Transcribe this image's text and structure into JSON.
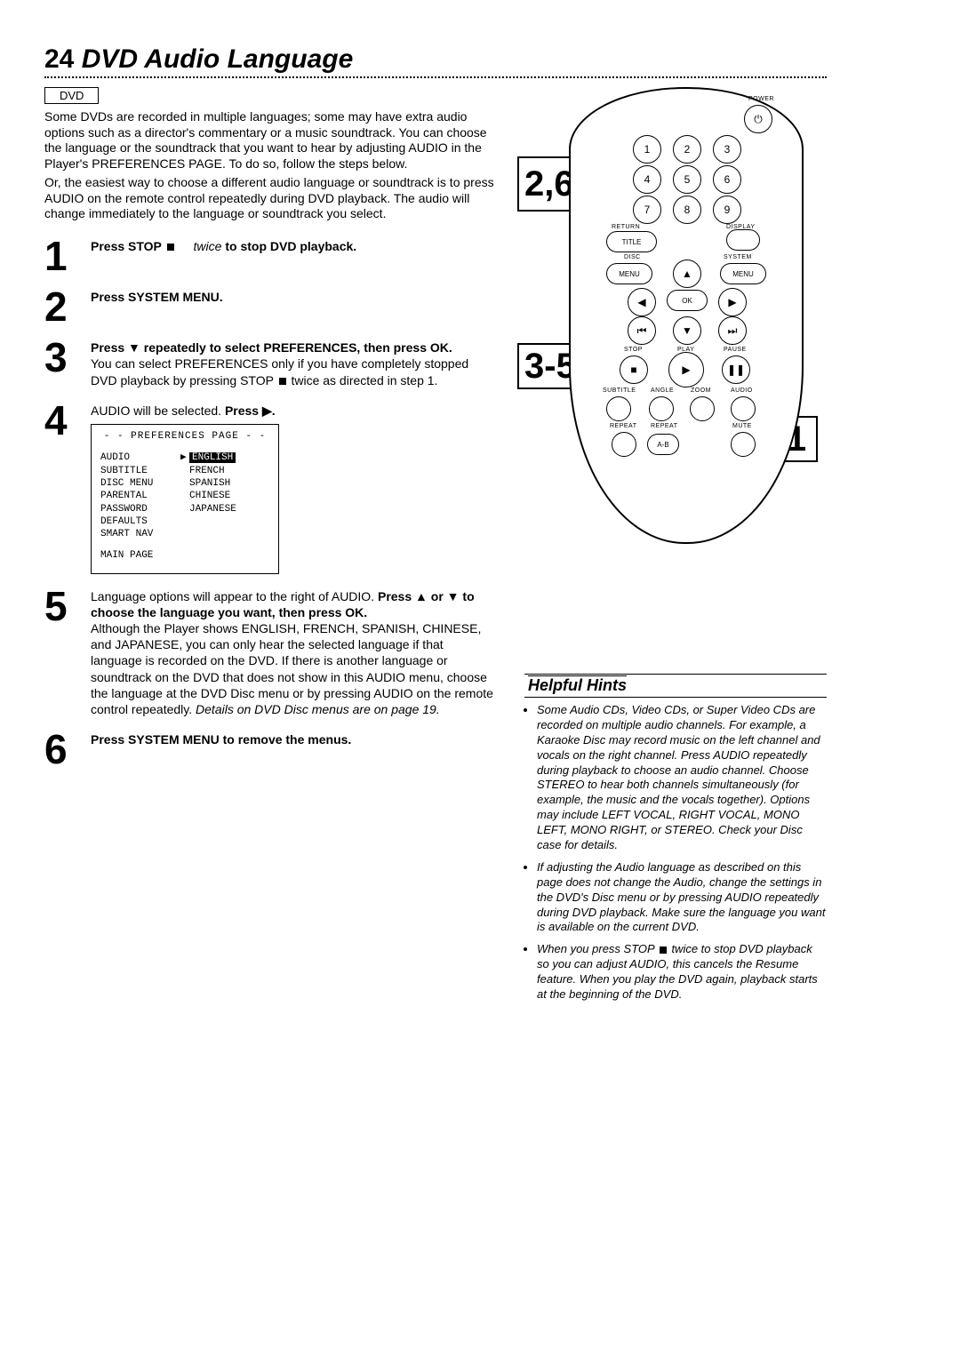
{
  "page": {
    "number": "24",
    "title": "DVD Audio Language"
  },
  "tag": "DVD",
  "intro": {
    "p1": "Some DVDs are recorded in multiple languages; some may have extra audio options such as a director's commentary or a music soundtrack. You can choose the language or the soundtrack that you want to hear by adjusting AUDIO in the Player's PREFERENCES PAGE. To do so, follow the steps below.",
    "p2": "Or, the easiest way to choose a different audio language or soundtrack is to press AUDIO on the remote control repeatedly during DVD playback. The audio will change immediately to the language or soundtrack you select."
  },
  "steps": {
    "s1": {
      "num": "1",
      "bold": "Press STOP ",
      "italic": "twice",
      "rest": " to stop DVD playback."
    },
    "s2": {
      "num": "2",
      "bold": "Press SYSTEM MENU."
    },
    "s3": {
      "num": "3",
      "bold": "Press ▼ repeatedly to select PREFERENCES, then press OK.",
      "rest1": "You can select PREFERENCES only if you have completely stopped DVD playback by pressing STOP ",
      "rest2": " twice as directed in step 1."
    },
    "s4": {
      "num": "4",
      "pre": "AUDIO will be selected. ",
      "bold": "Press ▶."
    },
    "s5": {
      "num": "5",
      "pre": "Language options will appear to the right of AUDIO. ",
      "bold1": "Press ▲ or ▼ to choose the language you want, then press OK.",
      "rest": "Although the Player shows ENGLISH, FRENCH, SPANISH, CHINESE, and JAPANESE, you can only hear the selected language if that language is recorded on the DVD. If there is another language or soundtrack on the DVD that does not show in this AUDIO menu, choose the language at the DVD Disc menu or by pressing AUDIO on the remote control repeatedly. ",
      "italic": "Details on DVD Disc menus are on page 19."
    },
    "s6": {
      "num": "6",
      "bold": "Press SYSTEM MENU to remove the menus."
    }
  },
  "osd": {
    "title": "- -  PREFERENCES PAGE  - -",
    "rows_left": [
      "AUDIO",
      "SUBTITLE",
      "DISC MENU",
      "PARENTAL",
      "PASSWORD",
      "DEFAULTS",
      "SMART NAV"
    ],
    "rows_right": [
      "ENGLISH",
      "FRENCH",
      "SPANISH",
      "CHINESE",
      "JAPANESE"
    ],
    "footer": "MAIN PAGE"
  },
  "remote": {
    "labels": {
      "power": "POWER",
      "return": "RETURN",
      "display": "DISPLAY",
      "title": "TITLE",
      "disc": "DISC",
      "system": "SYSTEM",
      "menu_l": "MENU",
      "menu_r": "MENU",
      "ok": "OK",
      "stop": "STOP",
      "play": "PLAY",
      "pause": "PAUSE",
      "subtitle": "SUBTITLE",
      "angle": "ANGLE",
      "zoom": "ZOOM",
      "audio": "AUDIO",
      "repeat": "REPEAT",
      "repeat2": "REPEAT",
      "mute": "MUTE",
      "ab": "A-B"
    },
    "digits": [
      "1",
      "2",
      "3",
      "4",
      "5",
      "6",
      "7",
      "8",
      "9"
    ]
  },
  "callouts": {
    "c26": "2,6",
    "c35": "3-5",
    "c1": "1"
  },
  "hints": {
    "title": "Helpful Hints",
    "h1": "Some Audio CDs, Video CDs, or Super Video CDs are recorded on multiple audio channels. For example, a Karaoke Disc may record music on the left channel and vocals on the right channel. Press AUDIO repeatedly during playback to choose an audio channel. Choose STEREO to hear both channels simultaneously (for example, the music and the vocals together). Options may include LEFT VOCAL, RIGHT VOCAL, MONO LEFT, MONO RIGHT, or STEREO. Check your Disc case for details.",
    "h2": "If adjusting the Audio language as described on this page does not change the Audio, change the settings in the DVD's Disc menu or by pressing AUDIO repeatedly during DVD playback. Make sure the language you want is available on the current DVD.",
    "h3a": "When you press STOP ",
    "h3b": " twice to stop DVD playback so you can adjust AUDIO, this cancels the Resume feature. When you play the DVD again, playback starts at the beginning of the DVD."
  }
}
